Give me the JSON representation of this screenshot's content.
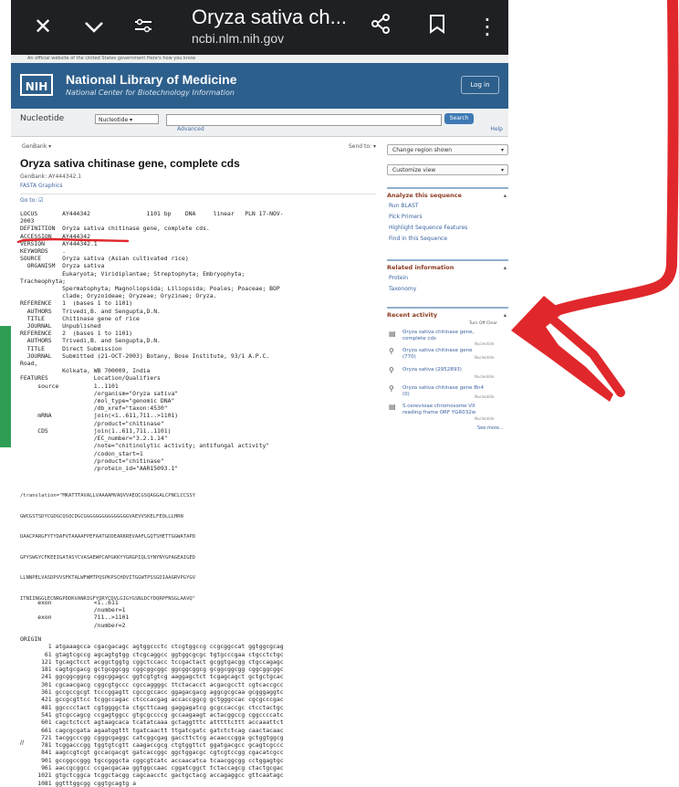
{
  "browser": {
    "page_title": "Oryza sativa ch...",
    "url": "ncbi.nlm.nih.gov",
    "icons": [
      "close-icon",
      "chevron-down-icon",
      "tune-icon",
      "share-icon",
      "bookmark-icon",
      "more-icon"
    ]
  },
  "gov_banner": "An official website of the United States government  Here's how you know",
  "nlm": {
    "logo": "NIH",
    "name": "National Library of Medicine",
    "subtitle": "National Center for Biotechnology Information",
    "login": "Log in"
  },
  "search": {
    "db_label": "Nucleotide",
    "db_selected": "Nucleotide",
    "button": "Search",
    "advanced": "Advanced",
    "help": "Help"
  },
  "record": {
    "format": "GenBank ▾",
    "send_to": "Send to: ▾",
    "title": "Oryza sativa chitinase gene, complete cds",
    "genbank_id": "GenBank: AY444342.1",
    "fasta_graphics": "FASTA   Graphics",
    "goto": "Go to: ☑"
  },
  "flatfile": "LOCUS       AY444342                1101 bp    DNA     linear   PLN 17-NOV-\n2003\nDEFINITION  Oryza sativa chitinase gene, complete cds.\nACCESSION   AY444342\nVERSION     AY444342.1\nKEYWORDS    .\nSOURCE      Oryza sativa (Asian cultivated rice)\n  ORGANISM  Oryza sativa\n            Eukaryota; Viridiplantae; Streptophyta; Embryophyta;\nTracheophyta;\n            Spermatophyta; Magnoliopsida; Liliopsida; Poales; Poaceae; BOP\n            clade; Oryzoideae; Oryzeae; Oryzinae; Oryza.\nREFERENCE   1  (bases 1 to 1101)\n  AUTHORS   Trivedi,B. and Sengupta,D.N.\n  TITLE     Chitinase gene of rice\n  JOURNAL   Unpublished\nREFERENCE   2  (bases 1 to 1101)\n  AUTHORS   Trivedi,B. and Sengupta,D.N.\n  TITLE     Direct Submission\n  JOURNAL   Submitted (21-OCT-2003) Botany, Bose Institute, 93/1 A.P.C.\nRoad,\n            Kolkata, WB 700009, India\nFEATURES             Location/Qualifiers\n     source          1..1101\n                     /organism=\"Oryza sativa\"\n                     /mol_type=\"genomic DNA\"\n                     /db_xref=\"taxon:4530\"\n     mRNA            join(<1..611,711..>1101)\n                     /product=\"chitinase\"\n     CDS             join(1..611,711..1101)\n                     /EC_number=\"3.2.1.14\"\n                     /note=\"chitinolytic activity; antifungal activity\"\n                     /codon_start=1\n                     /product=\"chitinase\"\n                     /protein_id=\"AAR15093.1\"",
  "translation": "/translation=\"MKATTTAVALLVAAAAMVAQVVAEQCGSQAGGALCPNCLCCSSY\nGWCGSTSDYCGDGCQSQCDGCGGGGGGGGGGGGGGGVAEVVSKELFEQLLLHRN\nDAACPARGFYTYDAFVTAAAAFPEFAATGDDEARKREVAAFLGQTSHETTGGWATAPD\nGPYSWGYCFKEEIGATASYCVASAEWPCAPGKKYYGRGPIQLSYNYNYGPAGEAIGED\nLLNNPELVASDPVVSFKTALWFWMTPQSPKPSCHDVITGGWTPSSGDIAAGRVPGYGV\nITNIINGGLECNRGPDDKVANRIGFYQRYCDVLGIGYGSNLDCYDQRPFNSGLAAVQ\"",
  "features2": "     exon            <1..611\n                     /number=1\n     exon            711..>1101\n                     /number=2",
  "origin": "ORIGIN\n        1 atgaaagcca cgacgacagc agtggccctc ctcgtggccg ccgcggccat ggtggcgcag\n       61 gtagtcgccg agcagtgtgg ctcgcaggcc ggtggcgcgc tgtgcccgaa ctgcctctgc\n      121 tgcagctcct acggctggtg cggctccacc tccgactact gcggtgacgg ctgccagagc\n      181 cagtgcgacg gctgcggcgg cggcggcggc ggcggcggcg gcggcggcgg cggcggcggc\n      241 ggcggcggcg cggcggagcc ggtcgtgtcg aaggagctct tcgagcagct gctgctgcac\n      301 cgcaacgacg cggcgtgccc cgccaggggc ttctacacct acgacgcctt cgtcaccgcc\n      361 gccgccgcgt tcccggagtt cgccgccacc ggagacgacg aggcgcgcaa gcgggaggtc\n      421 gccgcgttcc tcggccagac ctcccacgag accaccggcg gctgggccac cgcgcccgac\n      481 ggcccctact cgtggggcta ctgcttcaag gaggagatcg gcgccaccgc ctcctactgc\n      541 gtcgccagcg ccgagtggcc gtgcgccccg gccaagaagt actacggccg cggccccatc\n      601 cagctctcct agtaagcaca tcatatcaaa gctaggtttc atttttcttt accaaattct\n      661 cagcgcgata agaatggttt tgatcaactt ttgatcgatc gatctctcag caactacaac\n      721 tacggcccgg cgggcgaggc catcggcgag gaccttctcg acaacccgga gctggtggcg\n      781 tcggacccgg tggtgtcgtt caagaccgcg ctgtggttct ggatgacgcc gcagtcgccc\n      841 aagccgtcgt gccacgacgt gatcaccggc ggctggacgc cgtcgtccgg cgacatcgcc\n      901 gccggccggg tgccgggcta cggcgtcatc accaacatca tcaacggcgg cctggagtgc\n      961 aaccgcggcc ccgacgacaa ggtggccaac cggatcggct tctaccagcg ctactgcgac\n     1021 gtgctcggca tcggctacgg cagcaacctc gactgctacg accagaggcc gttcaatagc\n     1081 ggtttggcgg cggtgcagtg a",
  "end_mark": "//",
  "sidebar": {
    "change_region": "Change region shown",
    "customize_view": "Customize view",
    "analyze_title": "Analyze this sequence",
    "analyze_links": [
      "Run BLAST",
      "Pick Primers",
      "Highlight Sequence Features",
      "Find in this Sequence"
    ],
    "related_title": "Related information",
    "related_links": [
      "Protein",
      "Taxonomy"
    ],
    "recent_title": "Recent activity",
    "recent_controls": "Turn Off   Clear",
    "recent_items": [
      {
        "icon": "document-icon",
        "text": "Oryza sativa chitinase gene, complete cds",
        "sub": "Nucleotide"
      },
      {
        "icon": "search-icon",
        "text": "Oryza sativa chitinase gene (770)",
        "sub": "Nucleotide"
      },
      {
        "icon": "search-icon",
        "text": "Oryza sativa (2952893)",
        "sub": "Nucleotide"
      },
      {
        "icon": "search-icon",
        "text": "Oryza sativa chitinase gene Bn4 (0)",
        "sub": "Nucleotide"
      },
      {
        "icon": "document-icon",
        "text": "S.cerevisiae chromosome VII reading frame ORF YGR032w",
        "sub": "Nucleotide"
      }
    ],
    "see_more": "See more..."
  },
  "colors": {
    "chrome": "#1f2024",
    "nlm_header": "#2d5f8c",
    "annotation_red": "#e0282c",
    "green_strip": "#2f9e55",
    "heading_accent": "#8b3a1f"
  }
}
